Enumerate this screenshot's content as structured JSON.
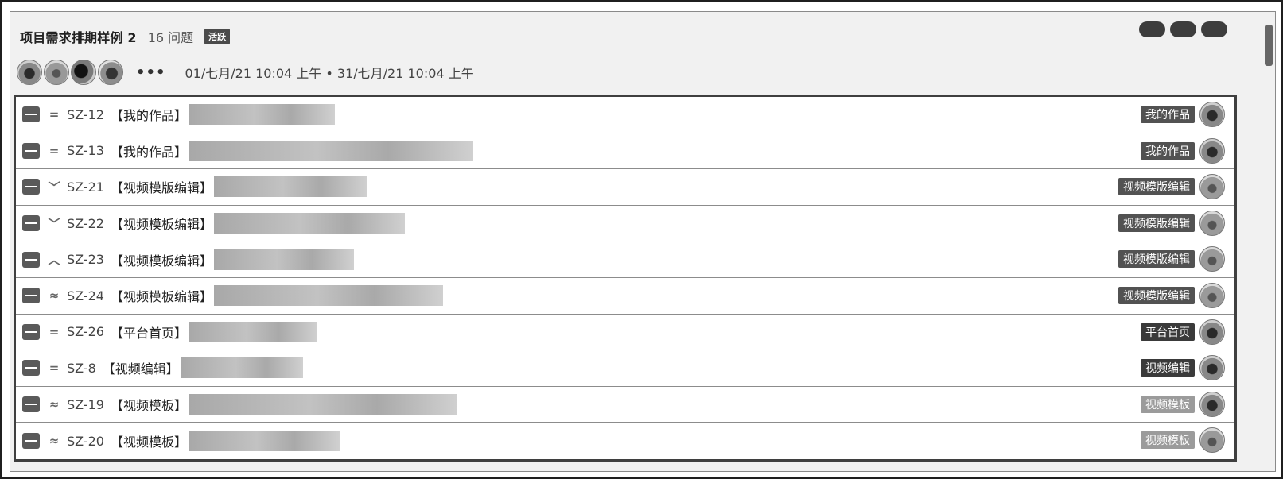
{
  "sprint": {
    "title": "项目需求排期样例 2",
    "issue_count": "16 问题",
    "status": "活跃",
    "more_label": "•••",
    "date_range": "01/七月/21 10:04 上午 • 31/七月/21 10:04 上午"
  },
  "issues": [
    {
      "key": "SZ-12",
      "title": "【我的作品】",
      "priority_icon": "equals-priority-icon",
      "priority_glyph": "=",
      "epic": "我的作品",
      "epic_style": "default",
      "assignee_avatar": "avatar-dog"
    },
    {
      "key": "SZ-13",
      "title": "【我的作品】",
      "priority_icon": "equals-priority-icon",
      "priority_glyph": "=",
      "epic": "我的作品",
      "epic_style": "default",
      "assignee_avatar": "avatar-dog"
    },
    {
      "key": "SZ-21",
      "title": "【视频模版编辑】",
      "priority_icon": "chevron-down-priority-icon",
      "priority_glyph": "﹀",
      "epic": "视频模版编辑",
      "epic_style": "default",
      "assignee_avatar": "avatar-cat"
    },
    {
      "key": "SZ-22",
      "title": "【视频模板编辑】",
      "priority_icon": "chevron-down-priority-icon",
      "priority_glyph": "﹀",
      "epic": "视频模版编辑",
      "epic_style": "default",
      "assignee_avatar": "avatar-cat"
    },
    {
      "key": "SZ-23",
      "title": "【视频模板编辑】",
      "priority_icon": "chevron-up-priority-icon",
      "priority_glyph": "︿",
      "epic": "视频模版编辑",
      "epic_style": "default",
      "assignee_avatar": "avatar-cat"
    },
    {
      "key": "SZ-24",
      "title": "【视频模板编辑】",
      "priority_icon": "double-chevron-up-priority-icon",
      "priority_glyph": "≈",
      "epic": "视频模版编辑",
      "epic_style": "default",
      "assignee_avatar": "avatar-cat"
    },
    {
      "key": "SZ-26",
      "title": "【平台首页】",
      "priority_icon": "equals-priority-icon",
      "priority_glyph": "=",
      "epic": "平台首页",
      "epic_style": "dark",
      "assignee_avatar": "avatar-dog"
    },
    {
      "key": "SZ-8",
      "title": "【视频编辑】",
      "priority_icon": "equals-priority-icon",
      "priority_glyph": "=",
      "epic": "视频编辑",
      "epic_style": "dark",
      "assignee_avatar": "avatar-dog"
    },
    {
      "key": "SZ-19",
      "title": "【视频模板】",
      "priority_icon": "double-chevron-up-priority-icon",
      "priority_glyph": "≈",
      "epic": "视频模板",
      "epic_style": "light",
      "assignee_avatar": "avatar-dog"
    },
    {
      "key": "SZ-20",
      "title": "【视频模板】",
      "priority_icon": "double-chevron-up-priority-icon",
      "priority_glyph": "≈",
      "epic": "视频模板",
      "epic_style": "light",
      "assignee_avatar": "avatar-cat"
    }
  ]
}
